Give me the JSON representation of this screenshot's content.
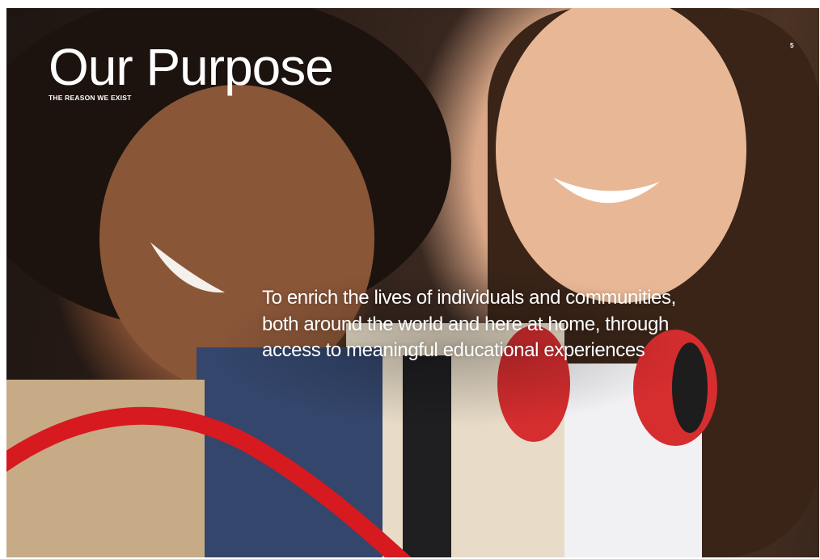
{
  "page": {
    "title": "Our Purpose",
    "subtitle": "THE REASON WE EXIST",
    "page_number": "5",
    "statement": "To enrich the lives of individuals and communities, both around the world and here at home, through access to meaningful educational experiences"
  },
  "photo": {
    "icon": "two-smiling-students-photo"
  },
  "colors": {
    "text": "#ffffff",
    "accent_swoosh": "#d71920"
  }
}
